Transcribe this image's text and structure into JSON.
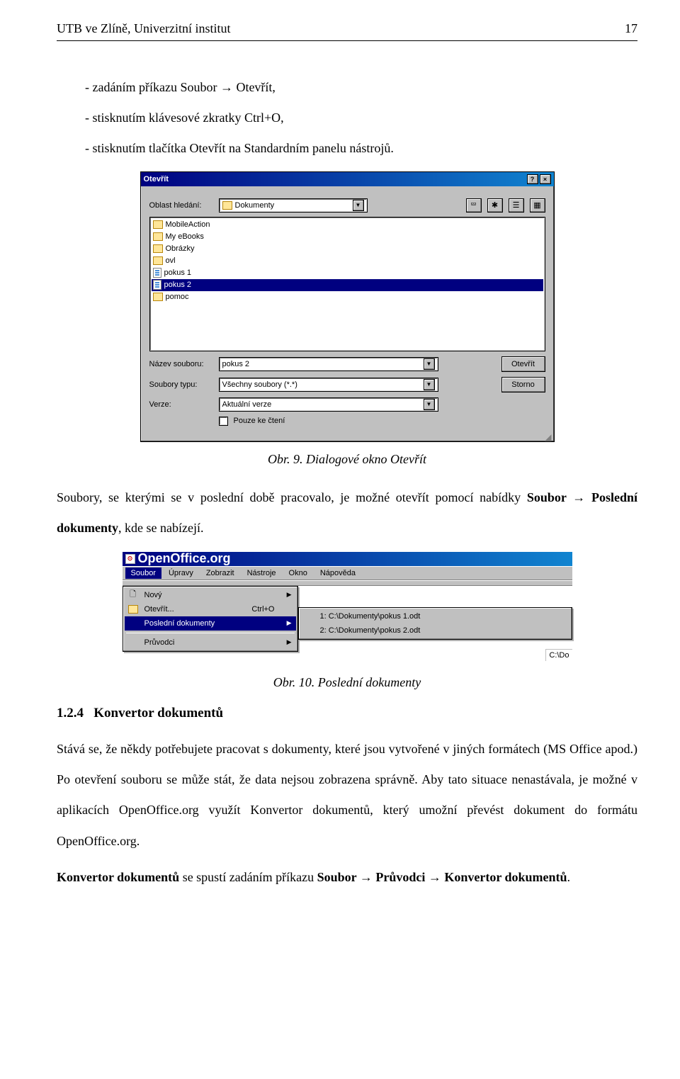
{
  "header": {
    "left": "UTB ve Zlíně, Univerzitní institut",
    "page": "17"
  },
  "bullets": [
    "-   zadáním příkazu Soubor → Otevřít,",
    "-   stisknutím klávesové zkratky Ctrl+O,",
    "-   stisknutím tlačítka Otevřít na Standardním panelu nástrojů."
  ],
  "fig9": {
    "caption": "Obr. 9. Dialogové okno Otevřít"
  },
  "para1a": "Soubory, se kterými se v poslední době pracovalo, je možné otevřít pomocí nabídky ",
  "para1b": "Soubor → Poslední dokumenty",
  "para1c": ", kde se nabízejí.",
  "fig10": {
    "caption": "Obr. 10. Poslední dokumenty"
  },
  "section_num": "1.2.4",
  "section_title": "Konvertor dokumentů",
  "para2": "Stává se, že někdy potřebujete pracovat s dokumenty, které jsou vytvořené v jiných formátech (MS Office apod.) Po otevření souboru se může stát, že data nejsou zobrazena správně. Aby tato situace nenastávala, je možné v aplikacích OpenOffice.org využít Konvertor dokumentů, který umožní převést dokument do formátu OpenOffice.org.",
  "para3a": "Konvertor dokumentů",
  "para3b": " se spustí zadáním příkazu ",
  "para3c": "Soubor → Průvodci → Konvertor dokumentů",
  "para3d": ".",
  "dlg_open": {
    "title": "Otevřít",
    "lookin_label": "Oblast hledání:",
    "lookin_value": "Dokumenty",
    "files": [
      {
        "name": "MobileAction",
        "type": "folder"
      },
      {
        "name": "My eBooks",
        "type": "folder"
      },
      {
        "name": "Obrázky",
        "type": "folder"
      },
      {
        "name": "ovl",
        "type": "folder"
      },
      {
        "name": "pokus 1",
        "type": "doc"
      },
      {
        "name": "pokus 2",
        "type": "doc",
        "selected": true
      },
      {
        "name": "pomoc",
        "type": "folder"
      }
    ],
    "filename_label": "Název souboru:",
    "filename_value": "pokus 2",
    "filetype_label": "Soubory typu:",
    "filetype_value": "Všechny soubory (*.*)",
    "version_label": "Verze:",
    "version_value": "Aktuální verze",
    "readonly_label": "Pouze ke čtení",
    "open_btn": "Otevřít",
    "cancel_btn": "Storno"
  },
  "oo": {
    "app_title": "OpenOffice.org",
    "menus": [
      "Soubor",
      "Úpravy",
      "Zobrazit",
      "Nástroje",
      "Okno",
      "Nápověda"
    ],
    "file_menu": {
      "new": "Nový",
      "open": "Otevřít...",
      "open_shortcut": "Ctrl+O",
      "recent": "Poslední dokumenty",
      "wizards": "Průvodci"
    },
    "recent_docs": [
      "1: C:\\Dokumenty\\pokus 1.odt",
      "2: C:\\Dokumenty\\pokus 2.odt"
    ],
    "recent_trunc": "C:\\Do"
  }
}
